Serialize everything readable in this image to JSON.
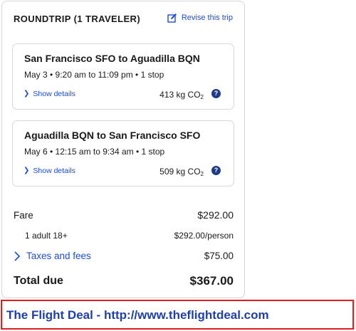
{
  "summary": {
    "title": "ROUNDTRIP (1 TRAVELER)",
    "revise_label": "Revise this trip"
  },
  "legs": [
    {
      "route": "San Francisco SFO to Aguadilla BQN",
      "times": "May 3 • 9:20 am to 11:09 pm • 1 stop",
      "details_label": "Show details",
      "co2_value": "413 kg CO",
      "co2_sub": "2",
      "info_symbol": "?"
    },
    {
      "route": "Aguadilla BQN to San Francisco SFO",
      "times": "May 6 • 12:15 am to 9:34 am • 1 stop",
      "details_label": "Show details",
      "co2_value": "509 kg CO",
      "co2_sub": "2",
      "info_symbol": "?"
    }
  ],
  "pricing": {
    "fare_label": "Fare",
    "fare_value": "$292.00",
    "adult_label": "1 adult 18+",
    "adult_value": "$292.00/person",
    "taxes_label": "Taxes and fees",
    "taxes_value": "$75.00",
    "total_label": "Total due",
    "total_value": "$367.00"
  },
  "banner": {
    "text": "The Flight Deal - http://www.theflightdeal.com"
  },
  "colors": {
    "link": "#1d4ed8",
    "info_icon": "#1e3a8a",
    "banner_border": "#e11d1d",
    "banner_text": "#1e3fb0"
  },
  "icons": {
    "revise": "edit-icon",
    "details": "chevron-right-icon",
    "info": "question-circle-icon",
    "taxes": "chevron-right-icon"
  }
}
